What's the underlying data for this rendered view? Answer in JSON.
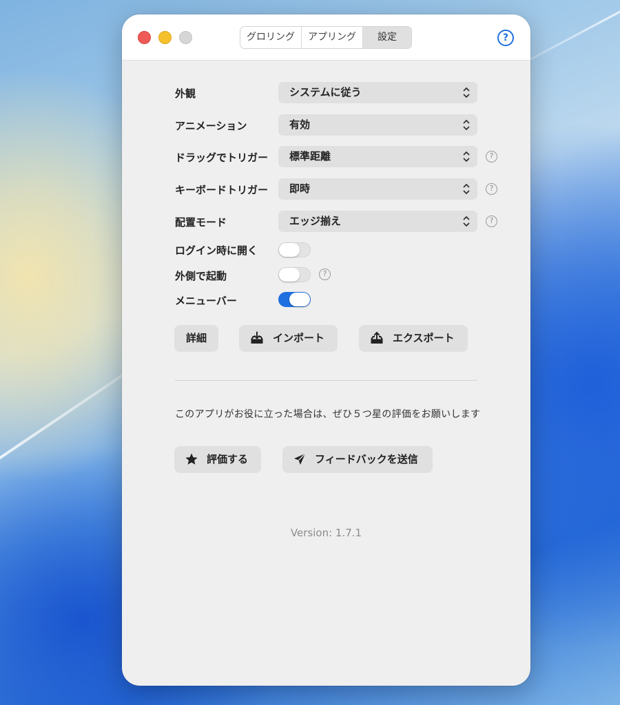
{
  "window": {
    "tabs": [
      "グロリング",
      "アプリング",
      "設定"
    ],
    "active_tab": "設定",
    "help_label": "?"
  },
  "settings": {
    "appearance": {
      "label": "外観",
      "value": "システムに従う"
    },
    "animation": {
      "label": "アニメーション",
      "value": "有効"
    },
    "drag_trigger": {
      "label": "ドラッグでトリガー",
      "value": "標準距離"
    },
    "keyboard_trigger": {
      "label": "キーボードトリガー",
      "value": "即時"
    },
    "placement_mode": {
      "label": "配置モード",
      "value": "エッジ揃え"
    },
    "open_at_login": {
      "label": "ログイン時に開く",
      "enabled": false
    },
    "launch_outside": {
      "label": "外側で起動",
      "enabled": false
    },
    "menu_bar": {
      "label": "メニューバー",
      "enabled": true
    }
  },
  "actions": {
    "details_label": "詳細",
    "import_label": "インポート",
    "export_label": "エクスポート"
  },
  "promo": {
    "text": "このアプリがお役に立った場合は、ぜひ５つ星の評価をお願いします",
    "rate_label": "評価する",
    "feedback_label": "フィードバックを送信"
  },
  "version": "Version: 1.7.1",
  "colors": {
    "accent": "#1f6fe0",
    "close": "#ee5a56",
    "minimize": "#f5c02c",
    "maximize_disabled": "#d6d6d6"
  },
  "icons": {
    "help": "question-circle-icon",
    "select": "chevron-up-down-icon",
    "import": "tray-arrow-down-icon",
    "export": "tray-arrow-up-icon",
    "rate": "star-icon",
    "feedback": "paperplane-icon"
  }
}
